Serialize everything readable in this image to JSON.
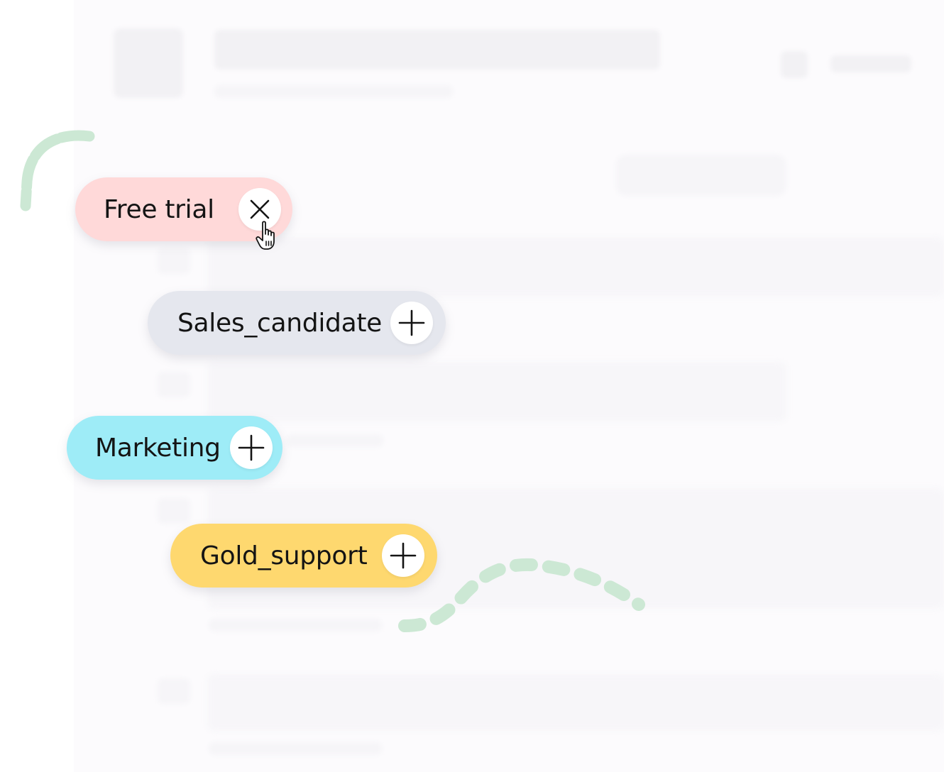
{
  "tags": [
    {
      "label": "Free trial",
      "action": "remove",
      "icon": "close-icon",
      "color": "#ffd9d9"
    },
    {
      "label": "Sales_candidate",
      "action": "add",
      "icon": "plus-icon",
      "color": "#e5e7ee"
    },
    {
      "label": "Marketing",
      "action": "add",
      "icon": "plus-icon",
      "color": "#9eecf7"
    },
    {
      "label": "Gold_support",
      "action": "add",
      "icon": "plus-icon",
      "color": "#fed86f"
    }
  ],
  "decoration": {
    "squiggle_color": "#cce8d4"
  },
  "cursor": {
    "icon": "hand-pointer-icon"
  }
}
